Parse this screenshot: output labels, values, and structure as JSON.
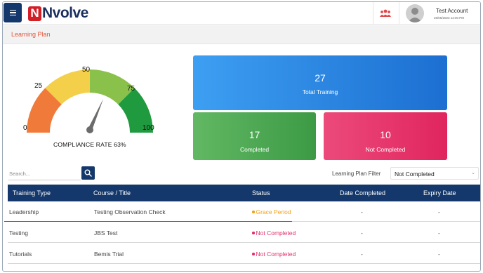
{
  "header": {
    "brand_mark": "N",
    "brand_name": "Nvolve",
    "account_name": "Test Account",
    "account_date": "26/06/2023 12:00 PM",
    "icons": [
      "menu-icon",
      "team-icon",
      "user-avatar-icon"
    ]
  },
  "page": {
    "title": "Learning Plan"
  },
  "gauge": {
    "labels": [
      "0",
      "25",
      "50",
      "75",
      "100"
    ],
    "value": 63,
    "caption": "COMPLIANCE RATE  63%",
    "colors": [
      "#f07a3a",
      "#f4cf4a",
      "#8ac14a",
      "#1f9a3e"
    ]
  },
  "cards": {
    "total": {
      "value": "27",
      "label": "Total Training",
      "color": "#2a85e0"
    },
    "completed": {
      "value": "17",
      "label": "Completed",
      "color": "#4caf50"
    },
    "not_completed": {
      "value": "10",
      "label": "Not Completed",
      "color": "#e63670"
    }
  },
  "search": {
    "placeholder": "Search..."
  },
  "filter": {
    "label": "Learning Plan Filter",
    "selected": "Not Completed"
  },
  "table": {
    "columns": [
      "Training Type",
      "Course / Title",
      "Status",
      "Date Completed",
      "Expiry Date"
    ],
    "rows": [
      {
        "type": "Leadership",
        "title": "Testing Observation Check",
        "status": "Grace Period",
        "status_color": "#f0a21b",
        "date_completed": "-",
        "expiry_date": "-"
      },
      {
        "type": "Testing",
        "title": "JBS Test",
        "status": "Not Completed",
        "status_color": "#e0306a",
        "date_completed": "-",
        "expiry_date": "-"
      },
      {
        "type": "Tutorials",
        "title": "Bemis Trial",
        "status": "Not Completed",
        "status_color": "#e0306a",
        "date_completed": "-",
        "expiry_date": "-"
      }
    ]
  }
}
